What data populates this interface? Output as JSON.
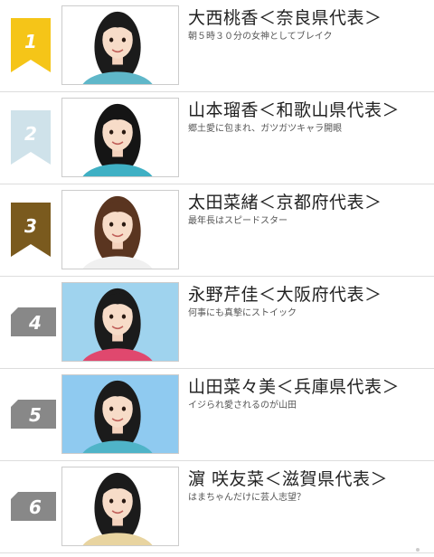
{
  "colors": {
    "gold": "#f5c518",
    "silver": "#cfe2ea",
    "bronze": "#7a5a1e",
    "plate": "#888888"
  },
  "rankings": [
    {
      "rank": "1",
      "badge": "gold-flag-icon",
      "name": "大西桃香＜奈良県代表＞",
      "caption": "朝５時３０分の女神としてブレイク",
      "photo_bg": "#ffffff",
      "hair": "#1b1b1b",
      "cloth": "#5fb7c9"
    },
    {
      "rank": "2",
      "badge": "silver-flag-icon",
      "name": "山本瑠香＜和歌山県代表＞",
      "caption": "郷土愛に包まれ、ガツガツキャラ開眼",
      "photo_bg": "#ffffff",
      "hair": "#151515",
      "cloth": "#3fb0c4"
    },
    {
      "rank": "3",
      "badge": "bronze-flag-icon",
      "name": "太田菜緒＜京都府代表＞",
      "caption": "最年長はスピードスター",
      "photo_bg": "#ffffff",
      "hair": "#5a3520",
      "cloth": "#f0f0f0"
    },
    {
      "rank": "4",
      "badge": "gray-plate-icon",
      "name": "永野芹佳＜大阪府代表＞",
      "caption": "何事にも真摯にストイック",
      "photo_bg": "#9fd3ee",
      "hair": "#1b1b1b",
      "cloth": "#e0486e"
    },
    {
      "rank": "5",
      "badge": "gray-plate-icon",
      "name": "山田菜々美＜兵庫県代表＞",
      "caption": "イジられ愛されるのが山田",
      "photo_bg": "#8fcaf0",
      "hair": "#1b1b1b",
      "cloth": "#4fb4c8"
    },
    {
      "rank": "6",
      "badge": "gray-plate-icon",
      "name": "濵 咲友菜＜滋賀県代表＞",
      "caption": "はまちゃんだけに芸人志望？",
      "photo_bg": "#ffffff",
      "hair": "#1b1b1b",
      "cloth": "#e8d4a0"
    }
  ]
}
